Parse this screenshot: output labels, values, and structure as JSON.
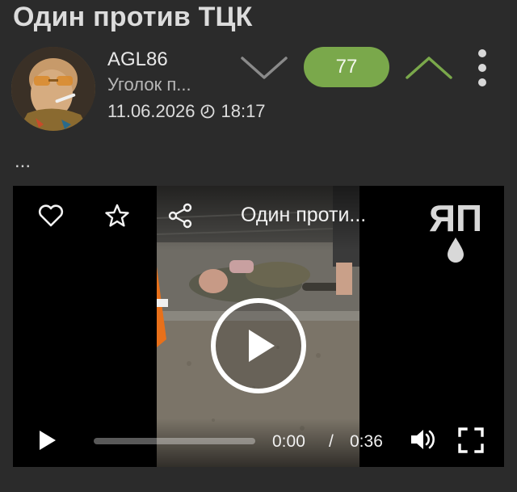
{
  "post": {
    "title": "Один против ТЦК",
    "author": "AGL86",
    "group": "Уголок п...",
    "date": "11.06.2026",
    "time": "18:17",
    "rating": "77",
    "body_text": "..."
  },
  "icons": {
    "vote_down": "chevron-down-icon",
    "vote_up": "chevron-up-icon",
    "more": "vertical-dots-icon",
    "clock": "clock-icon",
    "like": "heart-icon",
    "favorite": "star-icon",
    "share": "share-icon",
    "play": "play-icon",
    "volume": "volume-icon",
    "fullscreen": "fullscreen-icon"
  },
  "colors": {
    "background": "#2b2b2b",
    "rating_bg": "#7aa84b",
    "vote_up": "#7aa84b",
    "vote_down": "#8a8a8a"
  },
  "video": {
    "title": "Один проти...",
    "logo_text": "ЯП",
    "current_time": "0:00",
    "separator": "/",
    "duration": "0:36",
    "progress": 0
  }
}
